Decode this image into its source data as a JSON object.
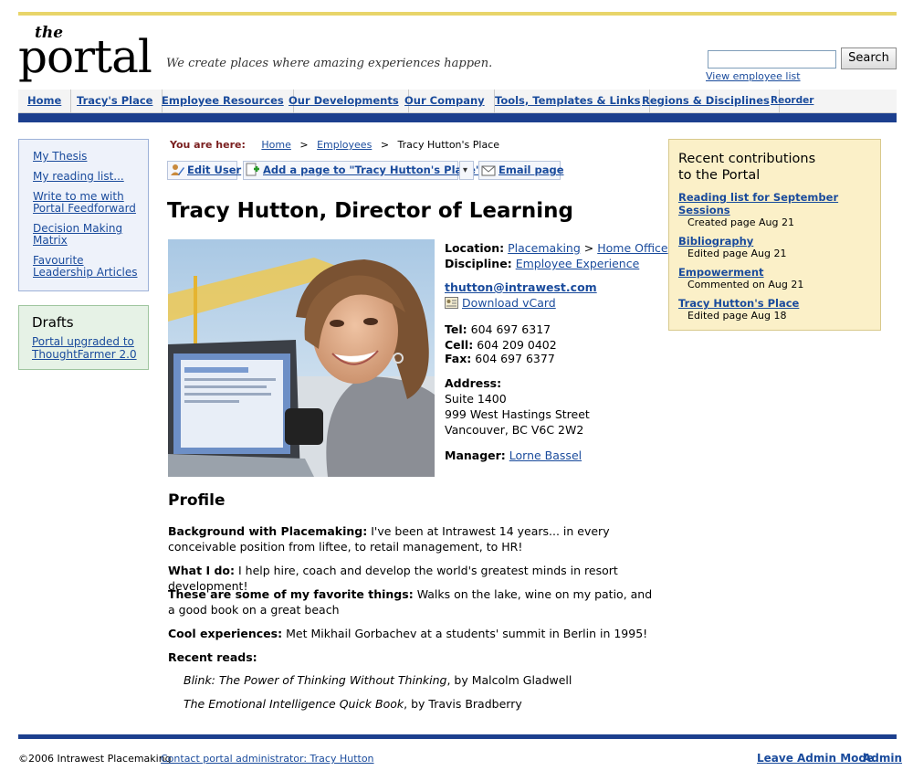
{
  "header": {
    "logo_the": "the",
    "logo_portal": "portal",
    "tagline": "We create places where amazing experiences happen.",
    "search_button": "Search",
    "search_value": "",
    "view_employee_list": "View employee list"
  },
  "nav": {
    "items": [
      "Home",
      "Tracy's Place",
      "Employee Resources",
      "Our Developments",
      "Our Company",
      "Tools, Templates & Links",
      "Regions & Disciplines",
      "Reorder"
    ]
  },
  "sidebar": {
    "links": [
      "My Thesis",
      "My reading list...",
      "Write to me with Portal Feedforward",
      "Decision Making Matrix",
      "Favourite Leadership Articles"
    ],
    "drafts_title": "Drafts",
    "drafts_items": [
      "Portal upgraded to ThoughtFarmer 2.0"
    ]
  },
  "breadcrumb": {
    "label": "You are here:",
    "home": "Home",
    "sep": ">",
    "employees": "Employees",
    "current": "Tracy Hutton's Place"
  },
  "toolbar": {
    "edit_user": "Edit User",
    "add_page": "Add a page to \"Tracy Hutton's Place\"",
    "dropdown": "▾",
    "email_page": "Email page"
  },
  "page": {
    "title": "Tracy Hutton, Director of Learning"
  },
  "contact": {
    "location_label": "Location:",
    "location_1": "Placemaking",
    "location_sep": ">",
    "location_2": "Home Office",
    "discipline_label": "Discipline:",
    "discipline": "Employee Experience",
    "email": "thutton@intrawest.com",
    "vcard": "Download vCard",
    "tel_label": "Tel:",
    "tel": "604 697 6317",
    "cell_label": "Cell:",
    "cell": "604 209 0402",
    "fax_label": "Fax:",
    "fax": "604 697 6377",
    "address_label": "Address:",
    "address_1": "Suite 1400",
    "address_2": "999 West Hastings Street",
    "address_3": "Vancouver, BC V6C 2W2",
    "manager_label": "Manager:",
    "manager": "Lorne Bassel"
  },
  "profile": {
    "heading": "Profile",
    "background_label": "Background with Placemaking:",
    "background_text": "I've been at Intrawest 14 years... in every conceivable position from liftee, to retail management, to HR!",
    "whatido_label": "What I do:",
    "whatido_text": "I help hire, coach and develop the world's greatest minds in resort development!",
    "favorites_label": "These are some of my favorite things:",
    "favorites_text": "Walks on the lake, wine on my patio, and a good book on a great beach",
    "cool_label": "Cool experiences:",
    "cool_text": "Met Mikhail Gorbachev at a students' summit in Berlin in 1995!",
    "reads_label": "Recent reads:",
    "read_1_title": "Blink: The Power of Thinking Without Thinking",
    "read_1_author": ", by Malcolm Gladwell",
    "read_2_title": "The Emotional Intelligence Quick Book",
    "read_2_author": ", by Travis Bradberry"
  },
  "recent": {
    "title_1": "Recent contributions",
    "title_2": "to the Portal",
    "entries": [
      {
        "link": "Reading list for September Sessions",
        "meta": "Created page Aug 21"
      },
      {
        "link": "Bibliography",
        "meta": "Edited page Aug 21"
      },
      {
        "link": "Empowerment",
        "meta": "Commented on Aug 21"
      },
      {
        "link": "Tracy Hutton's Place",
        "meta": "Edited page Aug 18"
      }
    ]
  },
  "footer": {
    "copyright": "©2006 Intrawest Placemaking",
    "contact_admin": "Contact portal administrator: Tracy Hutton",
    "leave_admin": "Leave Admin Mode",
    "admin": "Admin"
  },
  "colors": {
    "accent_bar": "#e8d56a",
    "nav_bottom": "#1c3f8e",
    "link": "#1a4b9c"
  }
}
